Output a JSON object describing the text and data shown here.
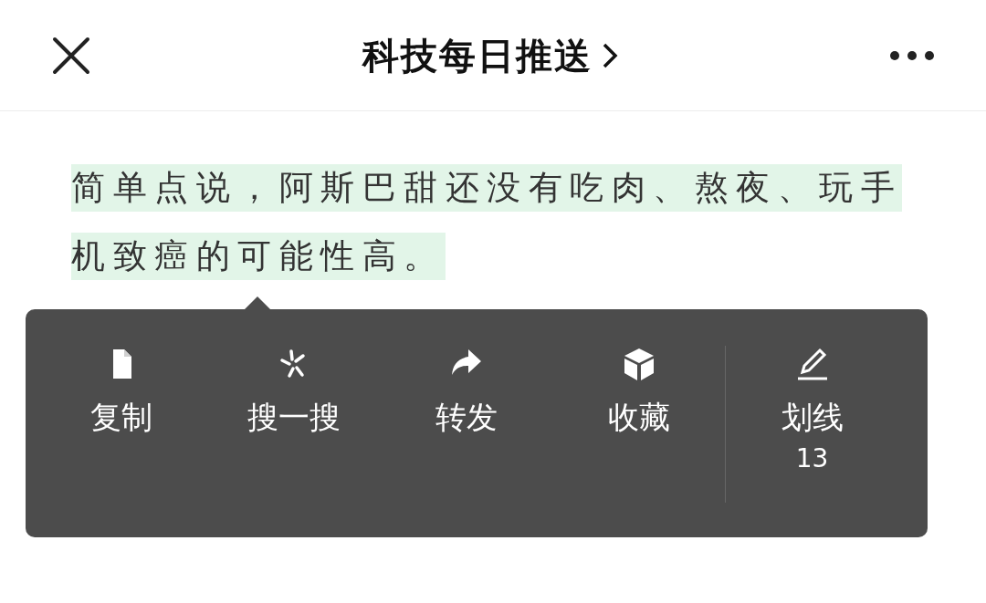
{
  "header": {
    "title": "科技每日推送"
  },
  "article": {
    "lines": [
      "简单点说，阿斯巴甜还没有吃肉、熬夜、玩手",
      "机致癌的可能性高。"
    ],
    "highlighted": true
  },
  "popup_menu": {
    "items": [
      {
        "kind": "copy",
        "label": "复制"
      },
      {
        "kind": "search",
        "label": "搜一搜"
      },
      {
        "kind": "forward",
        "label": "转发"
      },
      {
        "kind": "favorite",
        "label": "收藏"
      },
      {
        "kind": "underline",
        "label": "划线",
        "count": "13"
      }
    ]
  }
}
